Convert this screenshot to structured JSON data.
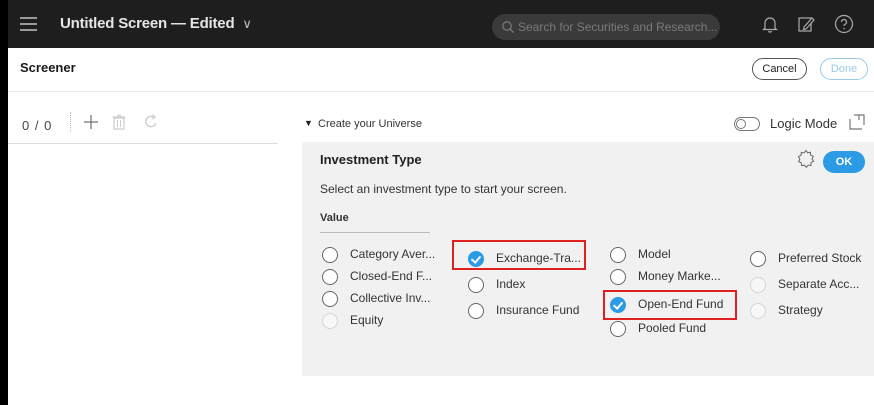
{
  "app": {
    "title": "Untitled Screen",
    "title_separator": "—",
    "edited_label": "Edited",
    "title_chevron": "∨"
  },
  "search": {
    "placeholder": "Search for Securities and Research..."
  },
  "topbar_icons": [
    "bell-icon",
    "edit-note-icon",
    "help-icon"
  ],
  "screener": {
    "title": "Screener",
    "cancel_label": "Cancel",
    "done_label": "Done"
  },
  "left_panel": {
    "counter": "0 / 0",
    "tools": [
      "add-icon",
      "trash-icon",
      "refresh-icon"
    ]
  },
  "universe": {
    "header": "Create your Universe",
    "logic_mode_label": "Logic Mode",
    "logic_mode_on": false
  },
  "investment_type": {
    "title": "Investment Type",
    "ok_label": "OK",
    "description": "Select an investment type to start your screen.",
    "value_label": "Value",
    "options": [
      {
        "label": "Category Aver...",
        "checked": false,
        "disabled": false
      },
      {
        "label": "Closed-End F...",
        "checked": false,
        "disabled": false
      },
      {
        "label": "Collective Inv...",
        "checked": false,
        "disabled": false
      },
      {
        "label": "Equity",
        "checked": false,
        "disabled": true
      },
      {
        "label": "Exchange-Tra...",
        "checked": true,
        "disabled": false
      },
      {
        "label": "Index",
        "checked": false,
        "disabled": false
      },
      {
        "label": "Insurance Fund",
        "checked": false,
        "disabled": false
      },
      {
        "label": "Model",
        "checked": false,
        "disabled": false
      },
      {
        "label": "Money Marke...",
        "checked": false,
        "disabled": false
      },
      {
        "label": "Open-End Fund",
        "checked": true,
        "disabled": false
      },
      {
        "label": "Pooled Fund",
        "checked": false,
        "disabled": false
      },
      {
        "label": "Preferred Stock",
        "checked": false,
        "disabled": false
      },
      {
        "label": "Separate Acc...",
        "checked": false,
        "disabled": true
      },
      {
        "label": "Strategy",
        "checked": false,
        "disabled": true
      }
    ]
  },
  "colors": {
    "accent": "#2b9be6",
    "topbar": "#1e1e1e",
    "highlight": "#e02020",
    "panel": "#f1f1f1"
  }
}
